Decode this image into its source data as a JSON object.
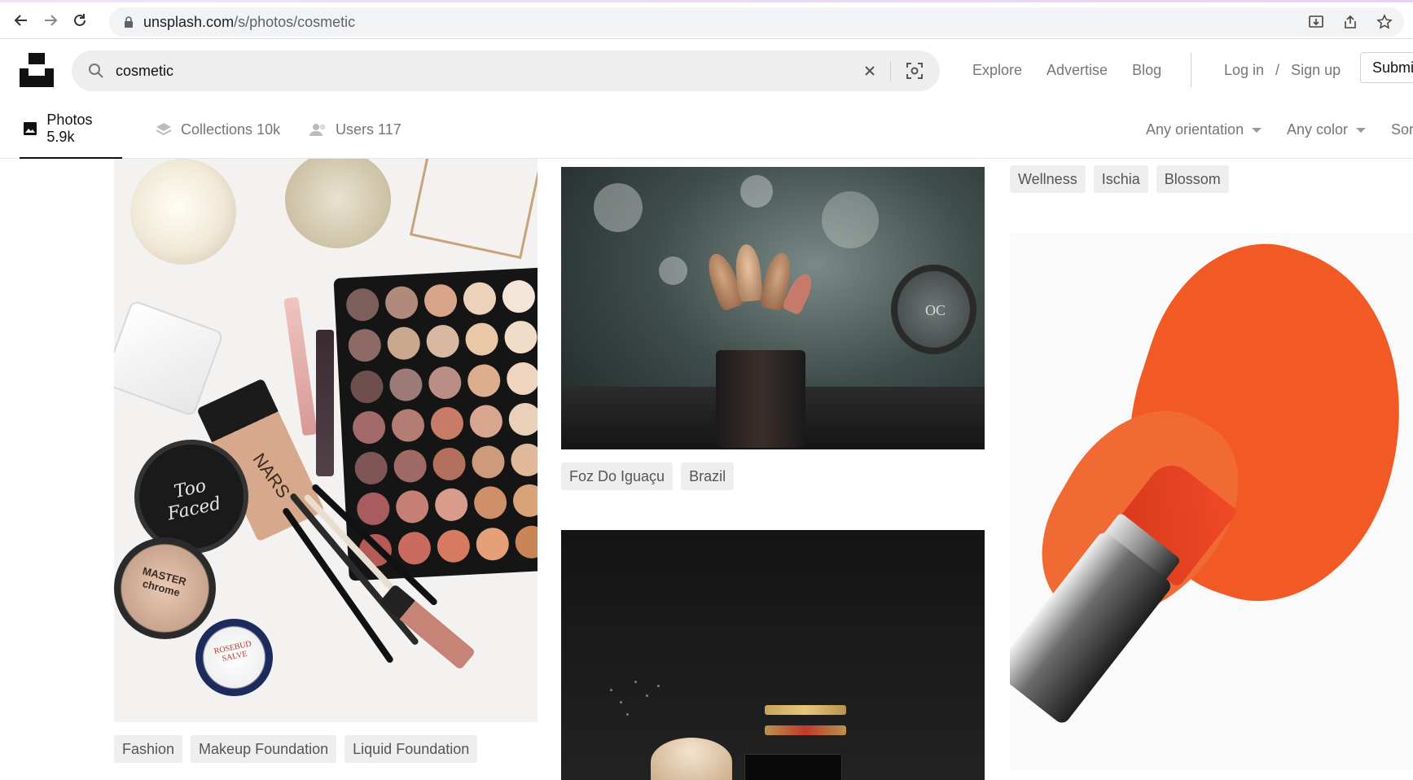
{
  "browser": {
    "url_domain": "unsplash.com",
    "url_path": "/s/photos/cosmetic"
  },
  "header": {
    "search_value": "cosmetic",
    "links": [
      "Explore",
      "Advertise",
      "Blog"
    ],
    "login": "Log in",
    "auth_sep": "/",
    "signup": "Sign up",
    "submit": "Submi"
  },
  "tabs": [
    {
      "label": "Photos",
      "count": "5.9k"
    },
    {
      "label": "Collections",
      "count": "10k"
    },
    {
      "label": "Users",
      "count": "117"
    }
  ],
  "filters": {
    "orientation": "Any orientation",
    "color": "Any color",
    "sort": "Sor"
  },
  "photo_tags": {
    "col1": [
      "Fashion",
      "Makeup Foundation",
      "Liquid Foundation"
    ],
    "col2": [
      "Foz Do Iguaçu",
      "Brazil"
    ],
    "col3": [
      "Wellness",
      "Ischia",
      "Blossom"
    ]
  },
  "photo_text": {
    "too_faced": "Too Faced",
    "nars": "NARS",
    "master_chrome": "MASTER chrome",
    "rosebud": "ROSEBUD SALVE",
    "oc": "OC"
  }
}
